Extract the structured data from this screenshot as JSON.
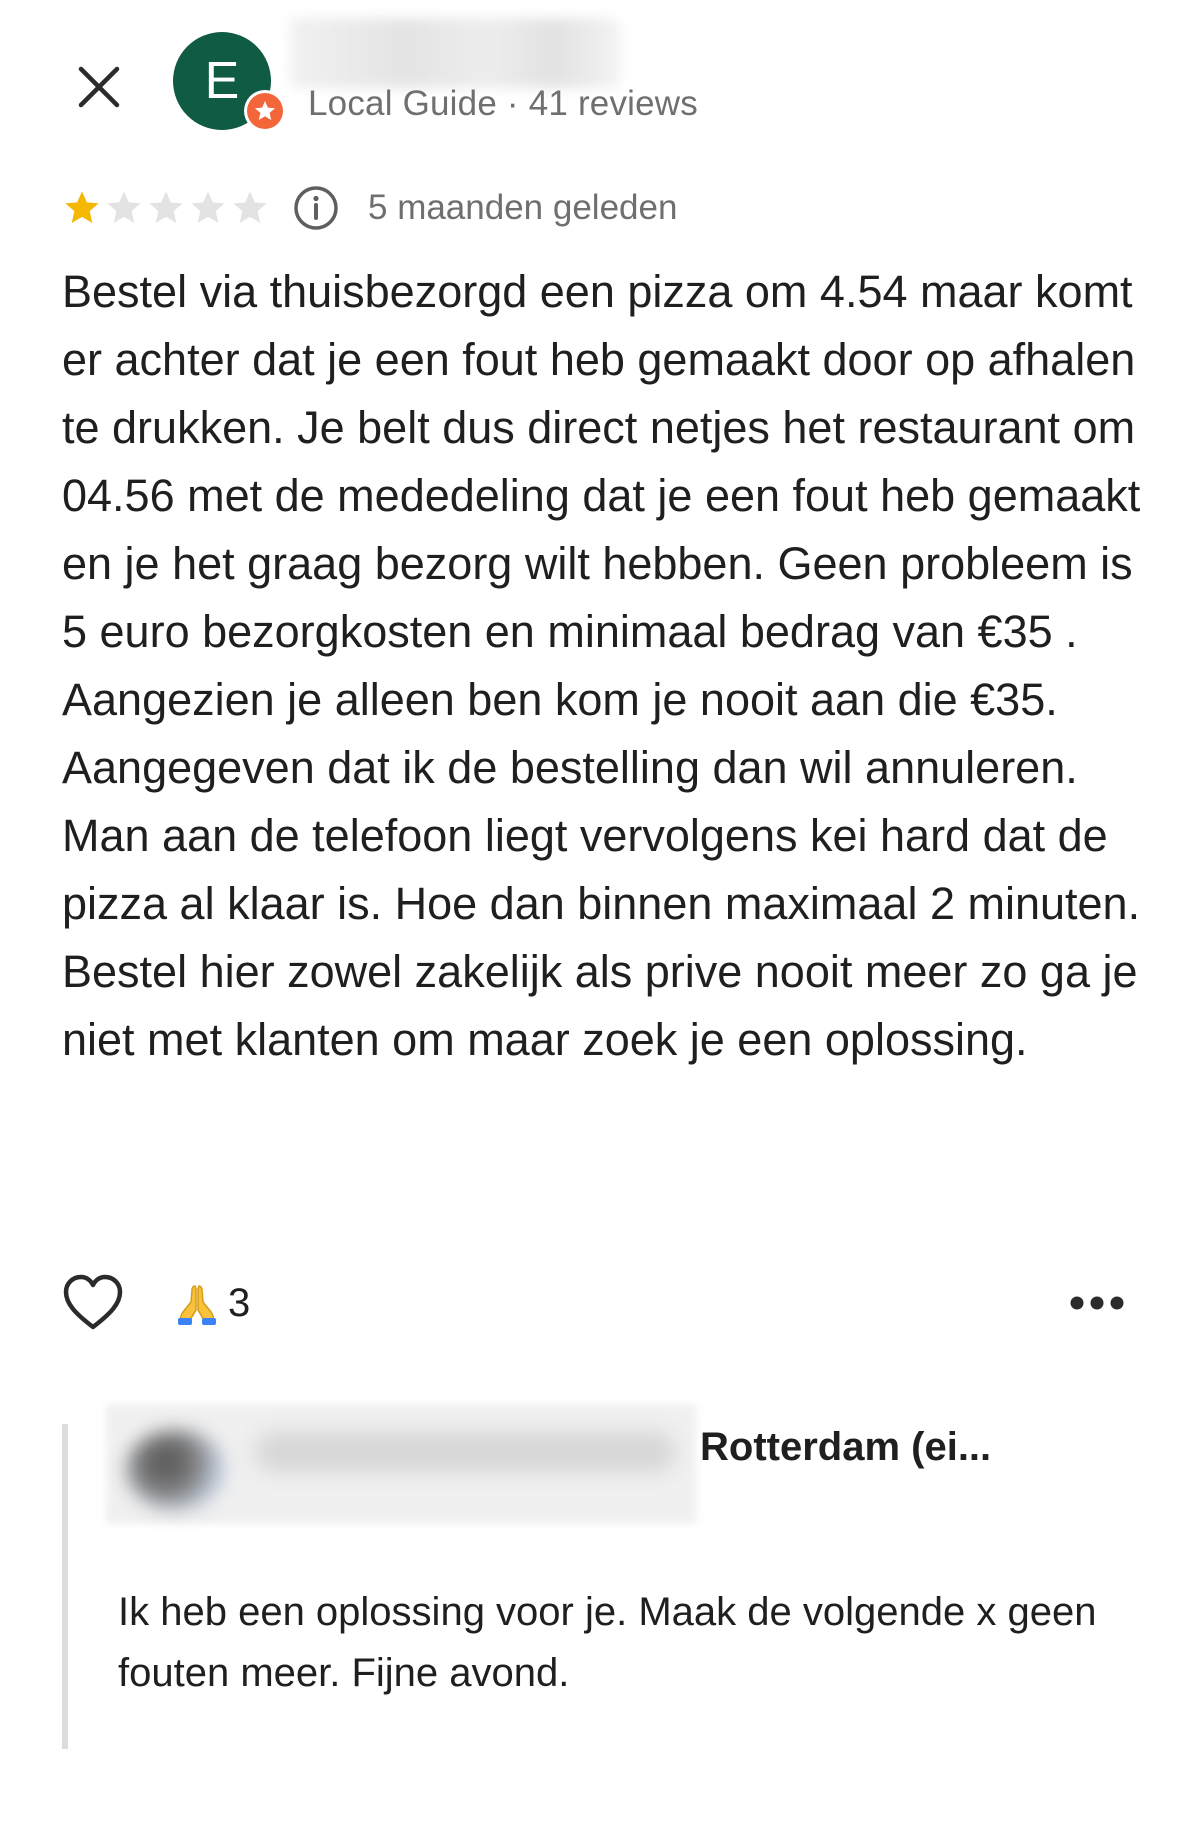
{
  "header": {
    "close_icon": "close-icon",
    "avatar_initial": "E",
    "avatar_color": "#0f5b43",
    "badge_icon": "local-guide-star-icon",
    "badge_color": "#f2663a",
    "reviewer_meta": "Local Guide · 41 reviews"
  },
  "rating": {
    "value": 1,
    "max": 5,
    "filled_color": "#f5b800",
    "empty_color": "#e3e3e3",
    "info_icon": "info-icon",
    "date": "5 maanden geleden"
  },
  "review": {
    "text": "Bestel via thuisbezorgd een pizza om 4.54 maar komt er achter dat je een fout heb gemaakt door op afhalen te drukken. Je belt dus direct netjes het restaurant om 04.56 met de mededeling dat je een fout heb gemaakt en je het graag bezorg wilt hebben. Geen probleem is 5 euro bezorgkosten en minimaal bedrag van €35 . Aangezien je alleen ben kom je nooit aan die €35. Aangegeven dat ik de bestelling dan wil annuleren. Man aan de telefoon liegt vervolgens kei hard dat de pizza al klaar is. Hoe dan binnen maximaal 2 minuten. Bestel hier zowel zakelijk als prive nooit meer zo ga je niet met klanten om maar zoek je een oplossing."
  },
  "actions": {
    "like_icon": "heart-icon",
    "reaction_icon": "folded-hands-icon",
    "reaction_count": "3",
    "more_icon": "more-horizontal-icon"
  },
  "owner_reply": {
    "owner_name": "Rotterdam (ei...",
    "text": "Ik heb een oplossing voor je. Maak de volgende x geen fouten meer. Fijne avond."
  }
}
